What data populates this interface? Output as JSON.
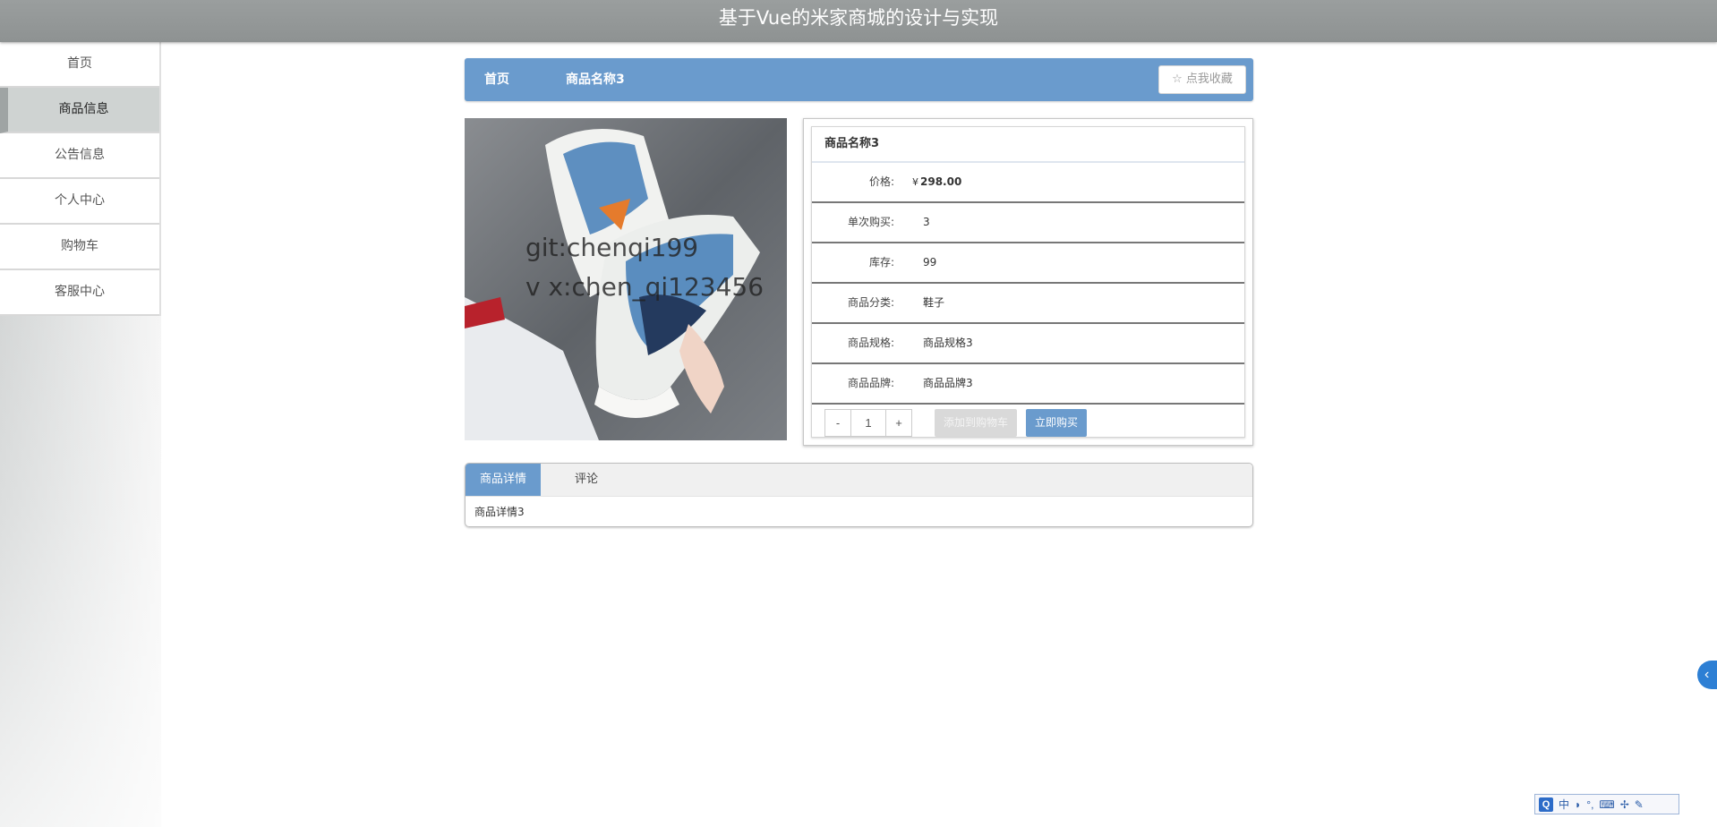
{
  "app": {
    "title": "基于Vue的米家商城的设计与实现"
  },
  "sidebar": {
    "items": [
      {
        "label": "首页"
      },
      {
        "label": "商品信息"
      },
      {
        "label": "公告信息"
      },
      {
        "label": "个人中心"
      },
      {
        "label": "购物车"
      },
      {
        "label": "客服中心"
      }
    ],
    "active_index": 1
  },
  "breadcrumb": {
    "home": "首页",
    "current": "商品名称3",
    "favorite_label": "☆ 点我收藏"
  },
  "product": {
    "image_watermark_line1": "git:chenqi199",
    "image_watermark_line2": "v x:chen_qi123456",
    "name": "商品名称3",
    "price_label": "价格:",
    "currency": "¥",
    "price": "298.00",
    "rows": [
      {
        "label": "单次购买:",
        "value": "3"
      },
      {
        "label": "库存:",
        "value": "99"
      },
      {
        "label": "商品分类:",
        "value": "鞋子"
      },
      {
        "label": "商品规格:",
        "value": "商品规格3"
      },
      {
        "label": "商品品牌:",
        "value": "商品品牌3"
      }
    ],
    "quantity": {
      "minus": "-",
      "value": "1",
      "plus": "+"
    },
    "add_to_cart_label": "添加到购物车",
    "buy_now_label": "立即购买"
  },
  "tabs": {
    "items": [
      {
        "label": "商品详情"
      },
      {
        "label": "评论"
      }
    ],
    "active_index": 0,
    "content": "商品详情3"
  },
  "side_toggle": {
    "icon": "chevron-left-icon",
    "glyph": "‹"
  },
  "ime": {
    "logo": "Q",
    "mode": "中",
    "items": [
      "◗",
      "°,",
      "⌨",
      "✢",
      "✎"
    ]
  },
  "colors": {
    "accent": "#6a9bcd",
    "topbar": "#949898",
    "sidebar_active": "#cfd3d2"
  }
}
